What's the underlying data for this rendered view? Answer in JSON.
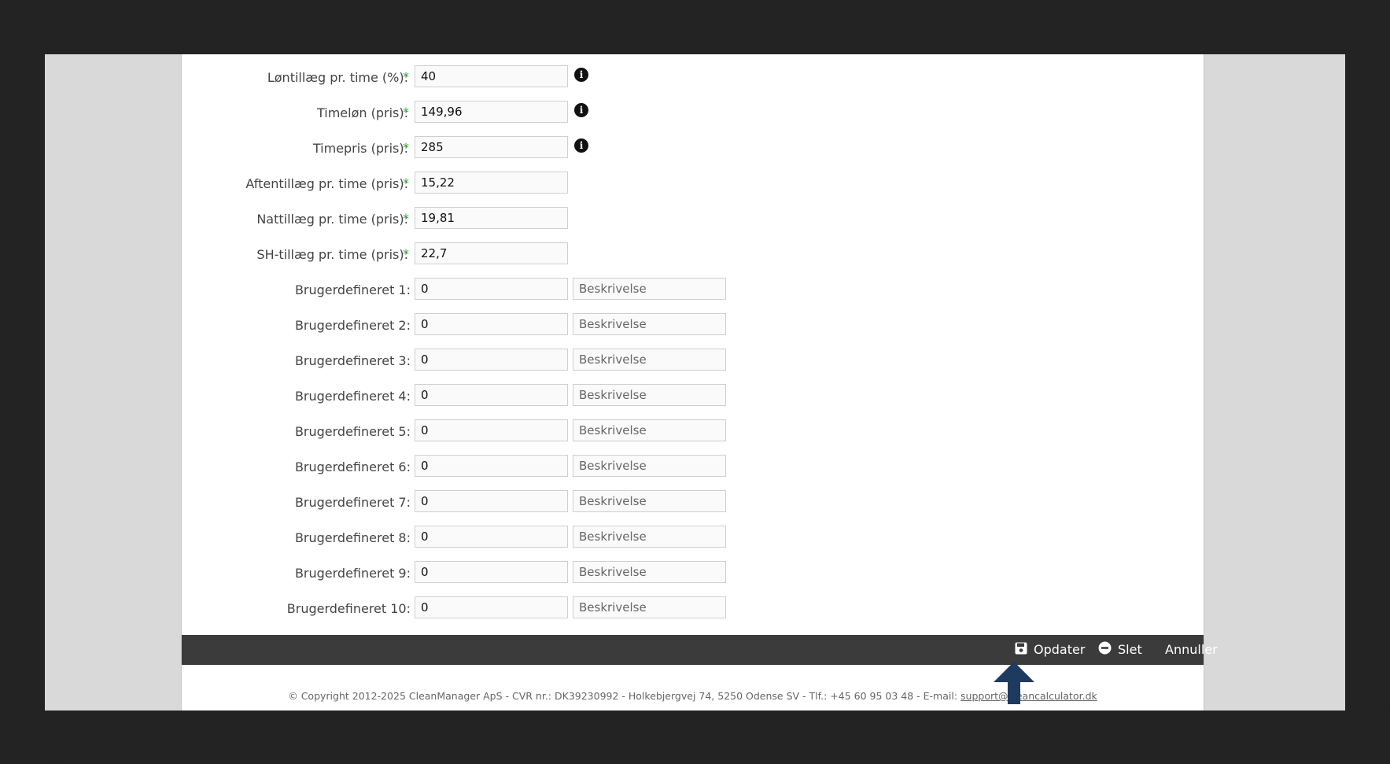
{
  "form": {
    "required_rows": [
      {
        "label": "Løntillæg pr. time (%):",
        "value": "40",
        "info": true
      },
      {
        "label": "Timeløn (pris):",
        "value": "149,96",
        "info": true
      },
      {
        "label": "Timepris (pris):",
        "value": "285",
        "info": true
      },
      {
        "label": "Aftentillæg pr. time (pris):",
        "value": "15,22",
        "info": false
      },
      {
        "label": "Nattillæg pr. time (pris):",
        "value": "19,81",
        "info": false
      },
      {
        "label": "SH-tillæg pr. time (pris):",
        "value": "22,7",
        "info": false
      }
    ],
    "required_marker": "*",
    "custom_rows": [
      {
        "label": "Brugerdefineret 1:",
        "value": "0",
        "description_placeholder": "Beskrivelse"
      },
      {
        "label": "Brugerdefineret 2:",
        "value": "0",
        "description_placeholder": "Beskrivelse"
      },
      {
        "label": "Brugerdefineret 3:",
        "value": "0",
        "description_placeholder": "Beskrivelse"
      },
      {
        "label": "Brugerdefineret 4:",
        "value": "0",
        "description_placeholder": "Beskrivelse"
      },
      {
        "label": "Brugerdefineret 5:",
        "value": "0",
        "description_placeholder": "Beskrivelse"
      },
      {
        "label": "Brugerdefineret 6:",
        "value": "0",
        "description_placeholder": "Beskrivelse"
      },
      {
        "label": "Brugerdefineret 7:",
        "value": "0",
        "description_placeholder": "Beskrivelse"
      },
      {
        "label": "Brugerdefineret 8:",
        "value": "0",
        "description_placeholder": "Beskrivelse"
      },
      {
        "label": "Brugerdefineret 9:",
        "value": "0",
        "description_placeholder": "Beskrivelse"
      },
      {
        "label": "Brugerdefineret 10:",
        "value": "0",
        "description_placeholder": "Beskrivelse"
      }
    ],
    "info_glyph": "i"
  },
  "toolbar": {
    "update_label": "Opdater",
    "delete_label": "Slet",
    "cancel_label": "Annuller",
    "update_icon": "floppy-disk-icon",
    "delete_icon": "minus-circle-icon"
  },
  "footer": {
    "text": "© Copyright 2012-2025 CleanManager ApS - CVR nr.: DK39230992 - Holkebjergvej 74, 5250 Odense SV - Tlf.: +45 60 95 03 48 - E-mail: ",
    "email": "support@cleancalculator.dk"
  },
  "colors": {
    "required_star": "#3aa63a",
    "toolbar_bg": "#3b3b3b",
    "arrow": "#1f3a5f"
  }
}
